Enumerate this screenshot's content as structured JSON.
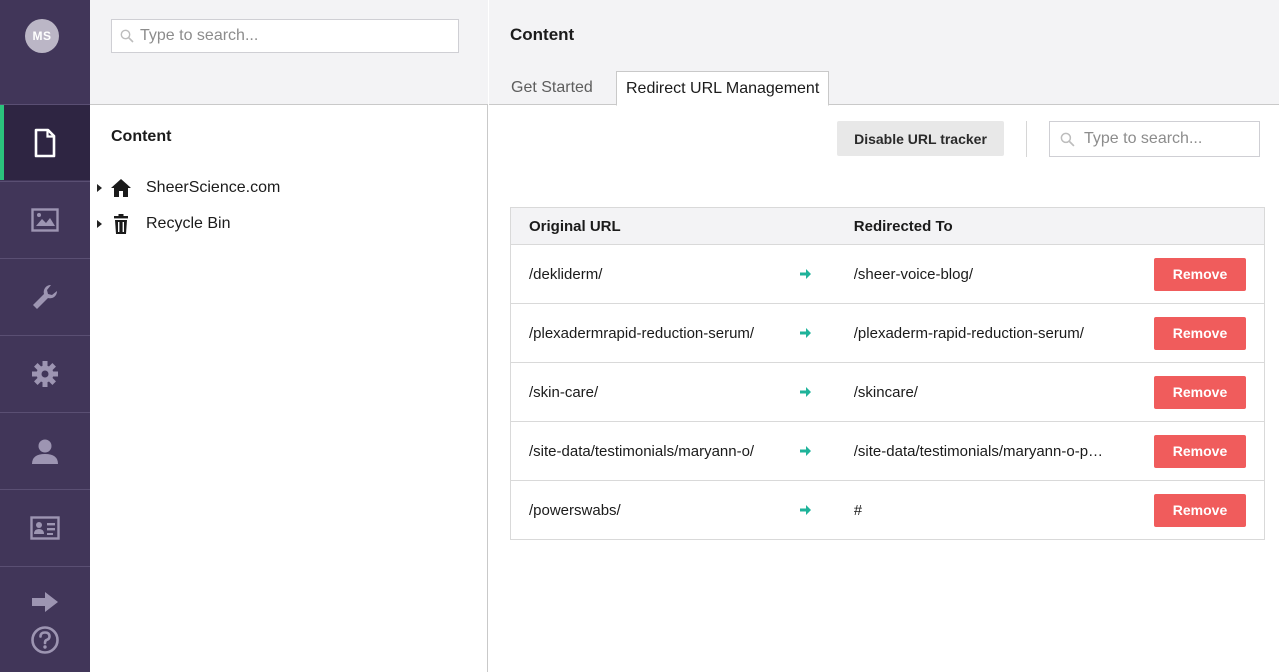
{
  "user": {
    "initials": "MS"
  },
  "nav": {
    "items": [
      {
        "name": "content",
        "icon": "document-icon",
        "active": true
      },
      {
        "name": "media",
        "icon": "image-icon",
        "active": false
      },
      {
        "name": "settings-tools",
        "icon": "wrench-icon",
        "active": false
      },
      {
        "name": "settings",
        "icon": "gear-icon",
        "active": false
      },
      {
        "name": "users",
        "icon": "person-icon",
        "active": false
      },
      {
        "name": "members",
        "icon": "id-card-icon",
        "active": false
      }
    ],
    "bottom": [
      {
        "name": "logout",
        "icon": "arrow-right-icon"
      },
      {
        "name": "help",
        "icon": "question-circle-icon"
      }
    ],
    "accent_color": "#2bc37c",
    "bg_color": "#413659"
  },
  "tree": {
    "search_placeholder": "Type to search...",
    "title": "Content",
    "nodes": [
      {
        "label": "SheerScience.com",
        "icon": "home-icon"
      },
      {
        "label": "Recycle Bin",
        "icon": "trash-icon"
      }
    ]
  },
  "main": {
    "title": "Content",
    "tabs": [
      {
        "label": "Get Started",
        "active": false
      },
      {
        "label": "Redirect URL Management",
        "active": true
      }
    ],
    "toolbar": {
      "disable_label": "Disable URL tracker",
      "search_placeholder": "Type to search..."
    },
    "table": {
      "headers": {
        "original": "Original URL",
        "redirected": "Redirected To"
      },
      "rows": [
        {
          "original": "/dekliderm/",
          "redirected": "/sheer-voice-blog/",
          "action": "Remove"
        },
        {
          "original": "/plexadermrapid-reduction-serum/",
          "redirected": "/plexaderm-rapid-reduction-serum/",
          "action": "Remove"
        },
        {
          "original": "/skin-care/",
          "redirected": "/skincare/",
          "action": "Remove"
        },
        {
          "original": "/site-data/testimonials/maryann-o/",
          "redirected": "/site-data/testimonials/maryann-o-p…",
          "action": "Remove"
        },
        {
          "original": "/powerswabs/",
          "redirected": "#",
          "action": "Remove"
        }
      ]
    },
    "remove_color": "#f05c5c",
    "arrow_color": "#1fb39a"
  }
}
